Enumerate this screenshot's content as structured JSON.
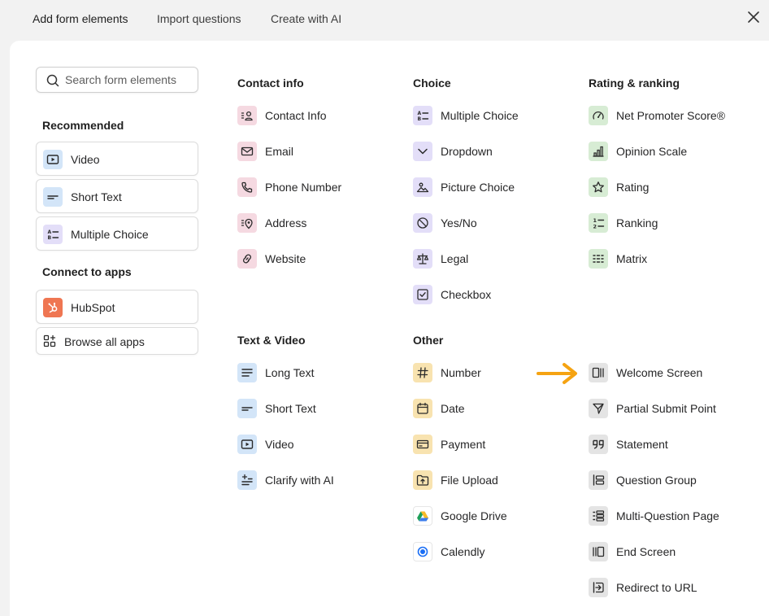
{
  "top_tabs": [
    {
      "label": "Add form elements"
    },
    {
      "label": "Import questions"
    },
    {
      "label": "Create with AI"
    }
  ],
  "search": {
    "placeholder": "Search form elements",
    "value": ""
  },
  "sidebar": {
    "recommended_heading": "Recommended",
    "recommended": [
      {
        "label": "Video",
        "icon": "video-icon"
      },
      {
        "label": "Short Text",
        "icon": "short-text-icon"
      },
      {
        "label": "Multiple Choice",
        "icon": "multiple-choice-icon"
      }
    ],
    "apps_heading": "Connect to apps",
    "apps": [
      {
        "label": "HubSpot",
        "icon": "hubspot-icon"
      },
      {
        "label": "Browse all apps",
        "icon": "apps-grid-icon"
      }
    ]
  },
  "sections": {
    "contact": {
      "heading": "Contact info",
      "items": [
        {
          "label": "Contact Info",
          "icon": "contact-card-icon"
        },
        {
          "label": "Email",
          "icon": "mail-icon"
        },
        {
          "label": "Phone Number",
          "icon": "phone-icon"
        },
        {
          "label": "Address",
          "icon": "location-pin-icon"
        },
        {
          "label": "Website",
          "icon": "link-icon"
        }
      ]
    },
    "choice": {
      "heading": "Choice",
      "items": [
        {
          "label": "Multiple Choice",
          "icon": "multiple-choice-icon"
        },
        {
          "label": "Dropdown",
          "icon": "chevron-down-icon"
        },
        {
          "label": "Picture Choice",
          "icon": "picture-icon"
        },
        {
          "label": "Yes/No",
          "icon": "yes-no-icon"
        },
        {
          "label": "Legal",
          "icon": "scales-icon"
        },
        {
          "label": "Checkbox",
          "icon": "checkbox-icon"
        }
      ]
    },
    "rating": {
      "heading": "Rating & ranking",
      "items": [
        {
          "label": "Net Promoter Score®",
          "icon": "gauge-icon"
        },
        {
          "label": "Opinion Scale",
          "icon": "bar-scale-icon"
        },
        {
          "label": "Rating",
          "icon": "star-icon"
        },
        {
          "label": "Ranking",
          "icon": "ranking-icon"
        },
        {
          "label": "Matrix",
          "icon": "matrix-icon"
        }
      ]
    },
    "text_video": {
      "heading": "Text & Video",
      "items": [
        {
          "label": "Long Text",
          "icon": "long-text-icon"
        },
        {
          "label": "Short Text",
          "icon": "short-text-icon"
        },
        {
          "label": "Video",
          "icon": "video-icon"
        },
        {
          "label": "Clarify with AI",
          "icon": "clarify-ai-icon"
        }
      ]
    },
    "other": {
      "heading": "Other",
      "items": [
        {
          "label": "Number",
          "icon": "hash-icon"
        },
        {
          "label": "Date",
          "icon": "calendar-icon"
        },
        {
          "label": "Payment",
          "icon": "credit-card-icon"
        },
        {
          "label": "File Upload",
          "icon": "file-upload-icon"
        },
        {
          "label": "Google Drive",
          "icon": "google-drive-icon"
        },
        {
          "label": "Calendly",
          "icon": "calendly-icon"
        }
      ]
    },
    "screens": {
      "items": [
        {
          "label": "Welcome Screen",
          "icon": "welcome-screen-icon"
        },
        {
          "label": "Partial Submit Point",
          "icon": "send-icon"
        },
        {
          "label": "Statement",
          "icon": "quote-icon"
        },
        {
          "label": "Question Group",
          "icon": "question-group-icon"
        },
        {
          "label": "Multi-Question Page",
          "icon": "multi-question-icon"
        },
        {
          "label": "End Screen",
          "icon": "end-screen-icon"
        },
        {
          "label": "Redirect to URL",
          "icon": "redirect-icon"
        }
      ]
    }
  },
  "colors": {
    "arrow": "#f5a312",
    "contact": "#f5d9e1",
    "text_video": "#d3e5f8",
    "choice": "#e3def8",
    "rating": "#d7ecd4",
    "other": "#f8e3b0",
    "screens": "#e4e4e4",
    "hubspot": "#ef7652"
  }
}
